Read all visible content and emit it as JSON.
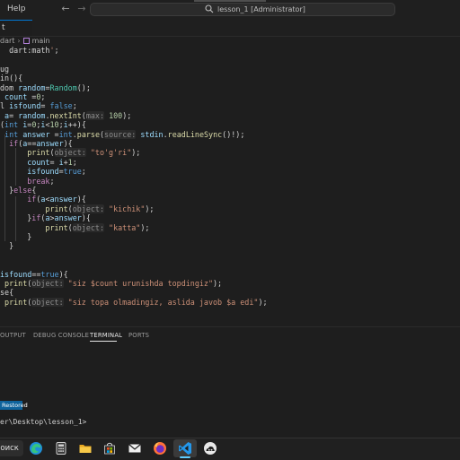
{
  "titlebar": {
    "menu_help": "Help",
    "search_text": "lesson_1 [Administrator]"
  },
  "tab": {
    "label": "t"
  },
  "breadcrumb": {
    "file": "dart",
    "symbol": "main"
  },
  "code": {
    "lines": [
      "  dart:math';",
      "",
      "ug",
      "in(){",
      "dom random=Random();",
      " count =0;",
      "l isfound= false;",
      " a= random.nextInt(max: 100);",
      "(int i=0;i<10;i++){",
      " int answer =int.parse(source: stdin.readLineSync()!);",
      "  if(a==answer){",
      "      print(object: \"to'g'ri\");",
      "      count= i+1;",
      "      isfound=true;",
      "      break;",
      "  }else{",
      "      if(a<answer){",
      "          print(object: \"kichik\");",
      "      }if(a>answer){",
      "          print(object: \"katta\");",
      "      }",
      "  }",
      "",
      "",
      "isfound==true){",
      " print(object: \"siz $count urunishda topdingiz\");",
      "se{",
      " print(object: \"siz topa olmadingiz, aslida javob $a edi\");"
    ]
  },
  "panel": {
    "tabs": [
      "OUTPUT",
      "DEBUG CONSOLE",
      "TERMINAL",
      "PORTS"
    ],
    "active_tab": "TERMINAL",
    "restored_badge": "Restored",
    "terminal_line": "er\\Desktop\\lesson_1>"
  },
  "taskbar": {
    "search_label": "Поиск",
    "icons": [
      "edge-icon",
      "calculator-icon",
      "file-explorer-icon",
      "microsoft-store-icon",
      "mail-icon",
      "firefox-icon",
      "vscode-icon",
      "cloud-app-icon"
    ]
  },
  "colors": {
    "editor_bg": "#1e1e1e",
    "keyword": "#569cd6",
    "control": "#c586c0",
    "function": "#dcdcaa",
    "type": "#4ec9b0",
    "variable": "#9cdcfe",
    "number": "#b5cea8",
    "string": "#ce9178",
    "accent": "#0078d4"
  }
}
